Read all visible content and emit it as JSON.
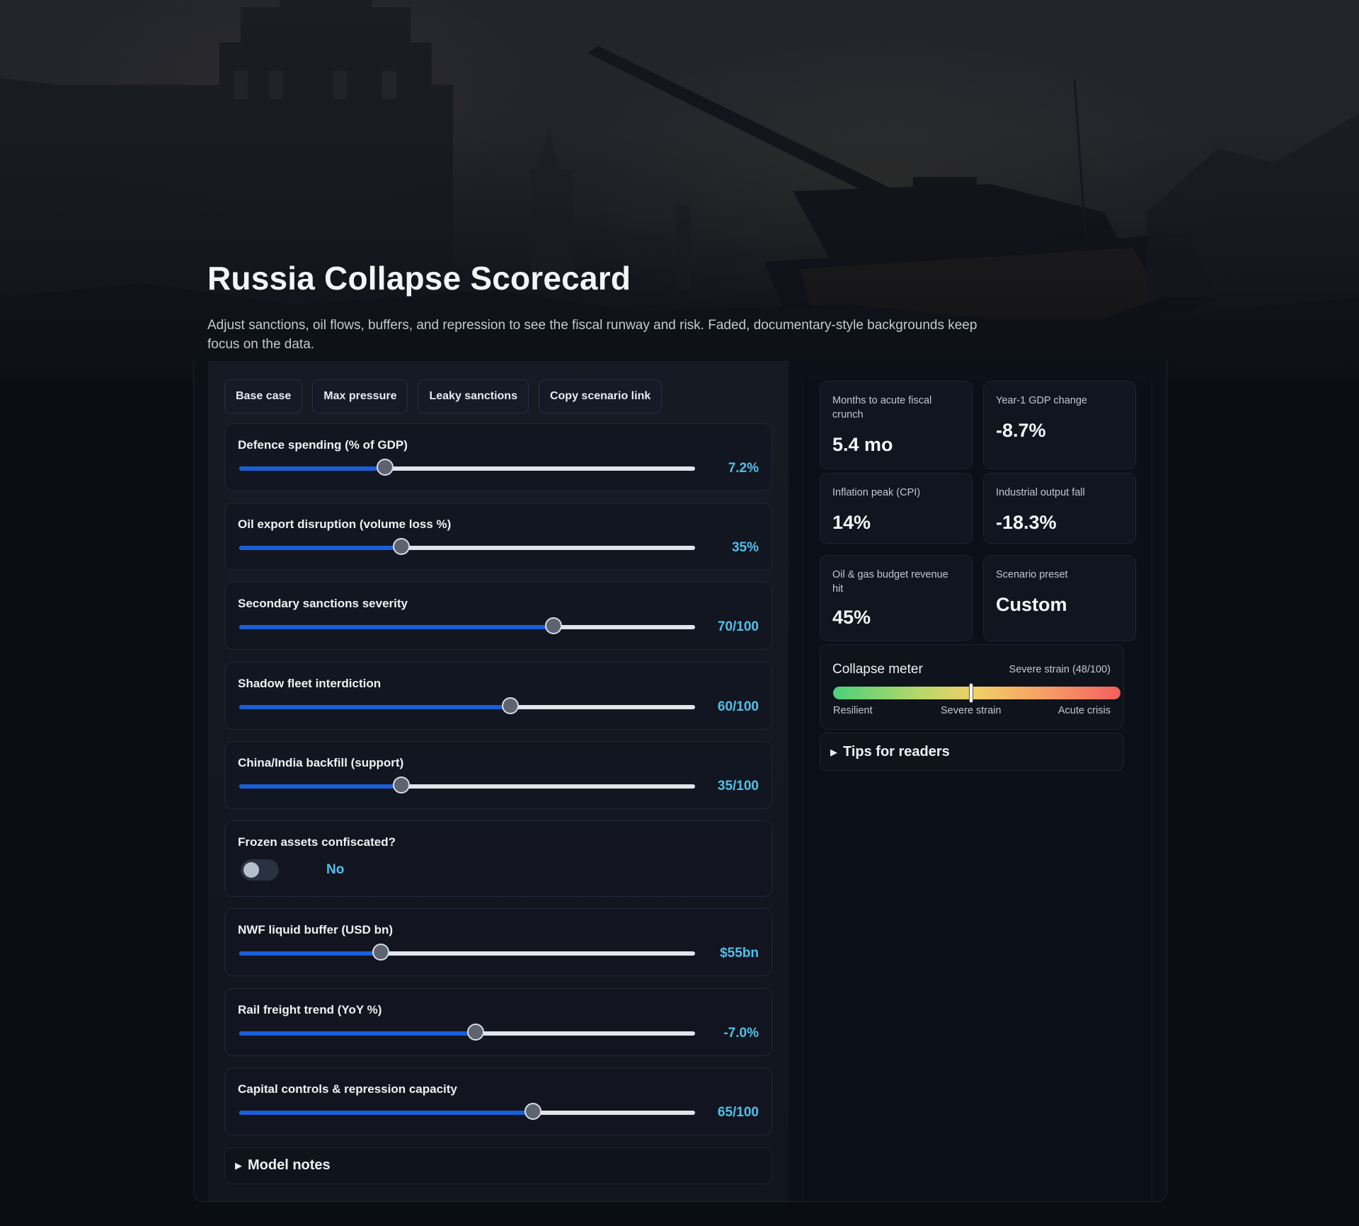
{
  "header": {
    "title": "Russia Collapse Scorecard",
    "subtitle": "Adjust sanctions, oil flows, buffers, and repression to see the fiscal runway and risk. Faded, documentary-style backgrounds keep focus on the data."
  },
  "presets": [
    "Base case",
    "Max pressure",
    "Leaky sanctions",
    "Copy scenario link"
  ],
  "controls": [
    {
      "label": "Defence spending (% of GDP)",
      "value": "7.2%",
      "level": 0.32
    },
    {
      "label": "Oil export disruption (volume loss %)",
      "value": "35%",
      "level": 0.355
    },
    {
      "label": "Secondary sanctions severity",
      "value": "70/100",
      "level": 0.69
    },
    {
      "label": "Shadow fleet interdiction",
      "value": "60/100",
      "level": 0.595
    },
    {
      "label": "China/India backfill (support)",
      "value": "35/100",
      "level": 0.355
    }
  ],
  "toggle": {
    "label": "Frozen assets confiscated?",
    "value": "No",
    "on": false
  },
  "controls2": [
    {
      "label": "NWF liquid buffer (USD bn)",
      "value": "$55bn",
      "level": 0.31
    },
    {
      "label": "Rail freight trend (YoY %)",
      "value": "-7.0%",
      "level": 0.518
    },
    {
      "label": "Capital controls & repression capacity",
      "value": "65/100",
      "level": 0.645
    }
  ],
  "model_notes": "Model notes",
  "stats": [
    {
      "label": "Months to acute fiscal crunch",
      "value": "5.4 mo"
    },
    {
      "label": "Year-1 GDP change",
      "value": "-8.7%"
    },
    {
      "label": "Inflation peak (CPI)",
      "value": "14%"
    },
    {
      "label": "Industrial output fall",
      "value": "-18.3%"
    },
    {
      "label": "Oil & gas budget revenue hit",
      "value": "45%"
    },
    {
      "label": "Scenario preset",
      "value": "Custom"
    }
  ],
  "meter": {
    "title": "Collapse meter",
    "status": "Severe strain (48/100)",
    "score": 48,
    "labels": [
      "Resilient",
      "Severe strain",
      "Acute crisis"
    ]
  },
  "tips": "Tips for readers",
  "colors": {
    "accent": "#4fc0ea",
    "slider_fill": "#1a5ed8",
    "background": "#0a0d14"
  }
}
